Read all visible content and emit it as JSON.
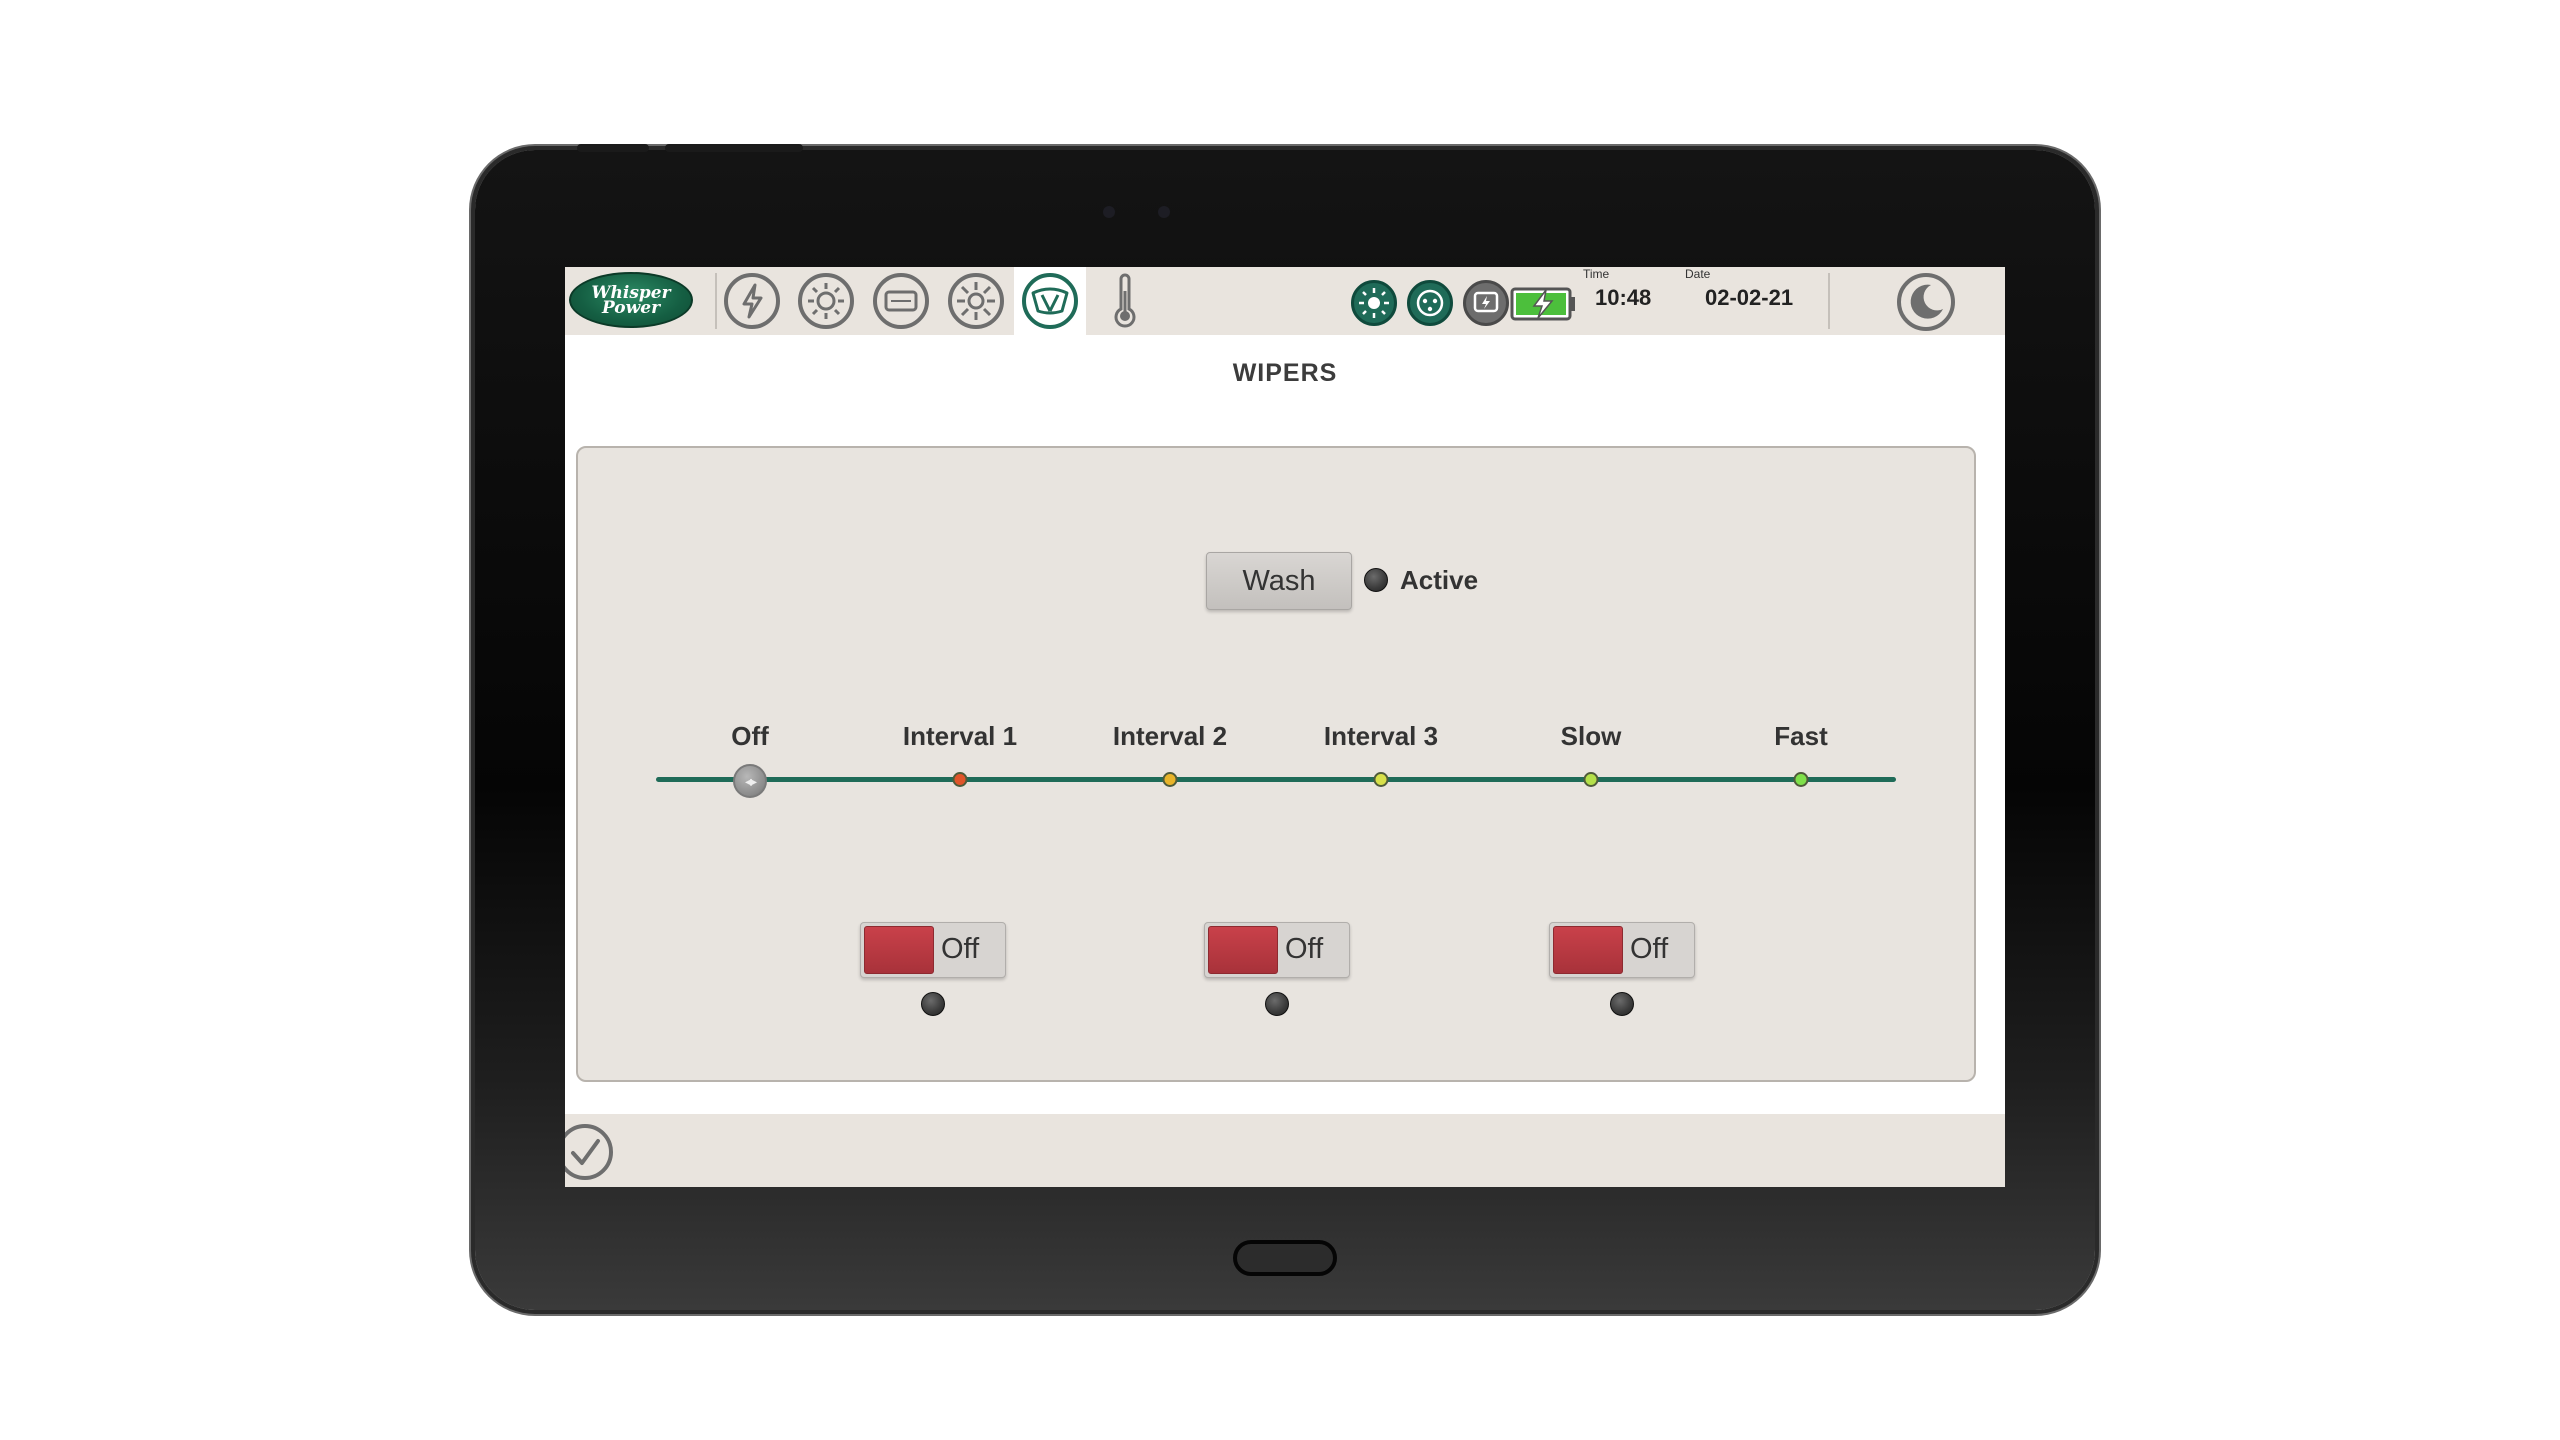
{
  "topbar": {
    "logo_line1": "Whisper",
    "logo_line2": "Power",
    "nav_icons": [
      "power-icon",
      "generator-icon",
      "display-icon",
      "heating-icon",
      "wipers-icon",
      "thermometer-icon"
    ],
    "active_nav": "wipers-icon",
    "status_icons": [
      "sun-icon",
      "shore-power-icon",
      "inverter-icon",
      "battery-charging-icon"
    ],
    "time_label": "Time",
    "time_value": "10:48",
    "date_label": "Date",
    "date_value": "02-02-21"
  },
  "page": {
    "title": "WIPERS"
  },
  "wash": {
    "button_label": "Wash",
    "status_label": "Active",
    "active": false
  },
  "speed": {
    "options": [
      "Off",
      "Interval 1",
      "Interval 2",
      "Interval 3",
      "Slow",
      "Fast"
    ],
    "selected": "Off",
    "dot_colors": [
      "#9e9e9e",
      "#e0552a",
      "#e8b42a",
      "#d7e04a",
      "#b4e04a",
      "#7fe04a"
    ]
  },
  "wipers": [
    {
      "state_label": "Off",
      "on": false
    },
    {
      "state_label": "Off",
      "on": false
    },
    {
      "state_label": "Off",
      "on": false
    }
  ],
  "colors": {
    "accent": "#1f6b58",
    "toggle_off": "#b83a42",
    "panel": "#e8e4df",
    "bar": "#e9e4de"
  }
}
